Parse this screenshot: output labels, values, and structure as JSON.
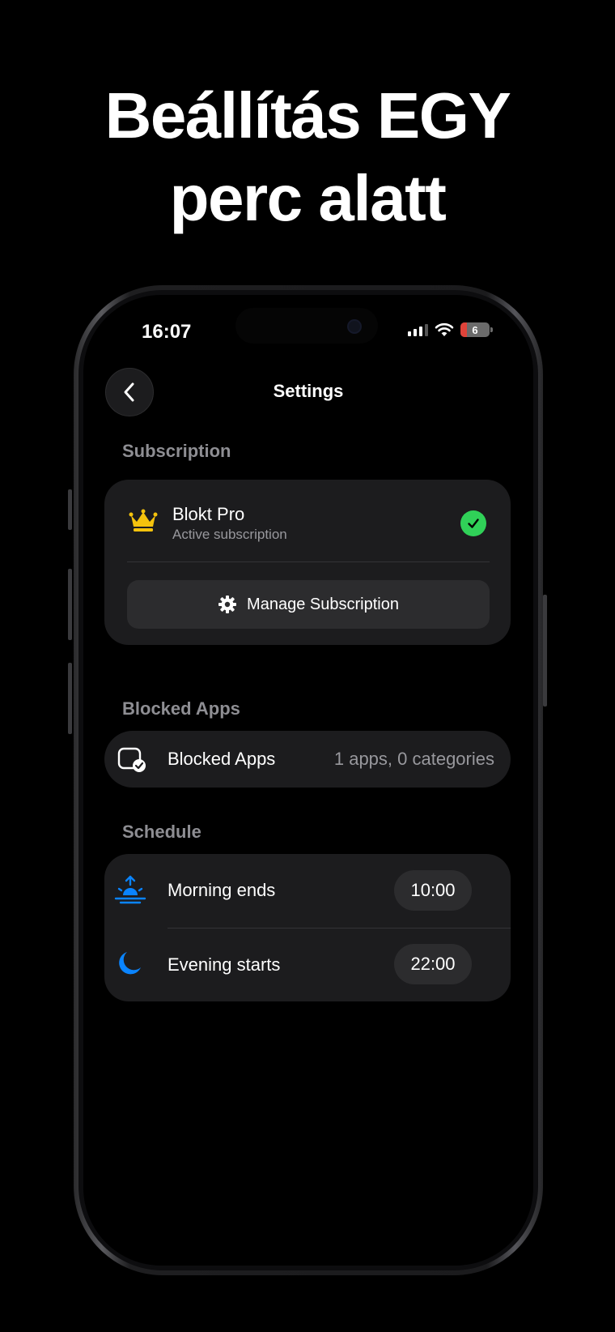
{
  "headline": {
    "line1": "Beállítás EGY",
    "line2": "perc alatt"
  },
  "status_bar": {
    "time": "16:07",
    "battery": "6"
  },
  "nav": {
    "title": "Settings",
    "back_icon": "chevron-left-icon"
  },
  "subscription": {
    "section_label": "Subscription",
    "plan_name": "Blokt Pro",
    "plan_status": "Active subscription",
    "manage_label": "Manage Subscription",
    "crown_color": "#f4c20d",
    "check_color": "#30d158"
  },
  "blocked_apps": {
    "section_label": "Blocked Apps",
    "row_label": "Blocked Apps",
    "row_value": "1 apps, 0 categories"
  },
  "schedule": {
    "section_label": "Schedule",
    "morning_label": "Morning ends",
    "morning_time": "10:00",
    "evening_label": "Evening starts",
    "evening_time": "22:00",
    "icon_color": "#0a84ff"
  }
}
